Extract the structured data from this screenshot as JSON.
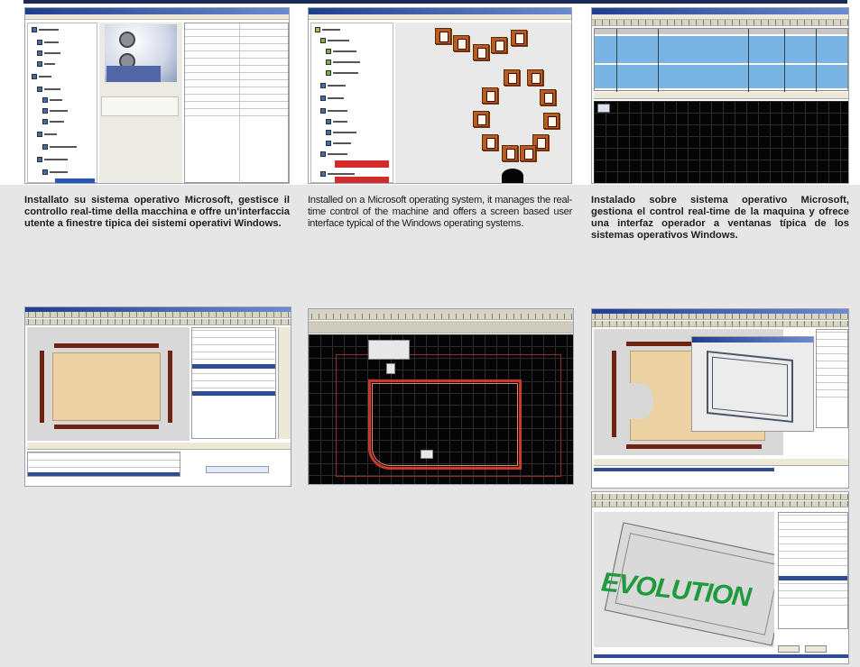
{
  "captions": {
    "it": "Installato su sistema operativo Microsoft, gestisce il controllo real-time della macchina e offre un'interfaccia utente a finestre tipica dei sistemi operativi Windows.",
    "en": "Installed on a Microsoft operating system, it manages the real-time control of the machine and offers a screen based user interface typical of the Windows operating systems.",
    "es": "Instalado sobre sistema operativo Microsoft, gestiona el control real-time de la maquina y ofrece una interfaz operador a ventanas típica de los sistemas operativos Windows."
  },
  "screenshots": {
    "evolution_logo_text": "EVOLUTION"
  },
  "colors": {
    "window_title": "#1f3e8e",
    "tile_orange": "#b85d1c",
    "logo_green": "#1f9a3c",
    "beam_brown": "#6e2410",
    "path_red": "#c83a2a"
  }
}
